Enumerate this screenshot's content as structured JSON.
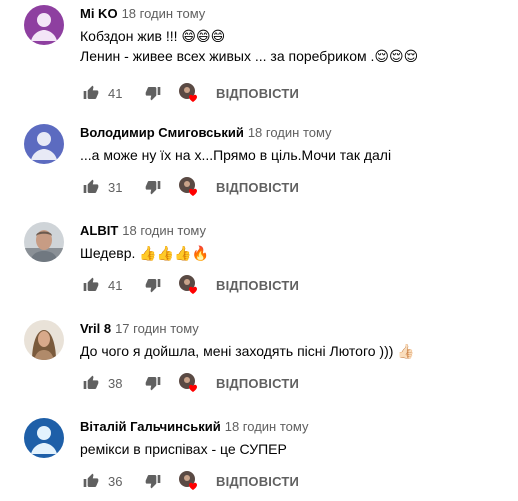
{
  "reply_label": "ВІДПОВІСТИ",
  "colors": {
    "heart": "#ff0000",
    "secondary_text": "#606060"
  },
  "comments": [
    {
      "author": "Mi KO",
      "time": "18 годин тому",
      "lines": [
        "Кобздон жив !!! 😄😄😄",
        "Ленин - живее всех живых ... за поребриком .😌😌😌"
      ],
      "likes": "41",
      "avatar": "purple-default"
    },
    {
      "author": "Володимир Смиговський",
      "time": "18 годин тому",
      "lines": [
        "...а може ну їх на х...Прямо в ціль.Мочи так далі"
      ],
      "likes": "31",
      "avatar": "lavender-default"
    },
    {
      "author": "ALBIT",
      "time": "18 годин тому",
      "lines": [
        "Шедевр. 👍👍👍🔥"
      ],
      "likes": "41",
      "avatar": "photo-man"
    },
    {
      "author": "Vril 8",
      "time": "17 годин тому",
      "lines": [
        "До чого я дойшла, мені заходять пісні Лютого ))) 👍🏻"
      ],
      "likes": "38",
      "avatar": "photo-woman"
    },
    {
      "author": "Віталій Гальчинський",
      "time": "18 годин тому",
      "lines": [
        "ремікси в приспівах - це СУПЕР"
      ],
      "likes": "36",
      "avatar": "blue-default"
    }
  ]
}
